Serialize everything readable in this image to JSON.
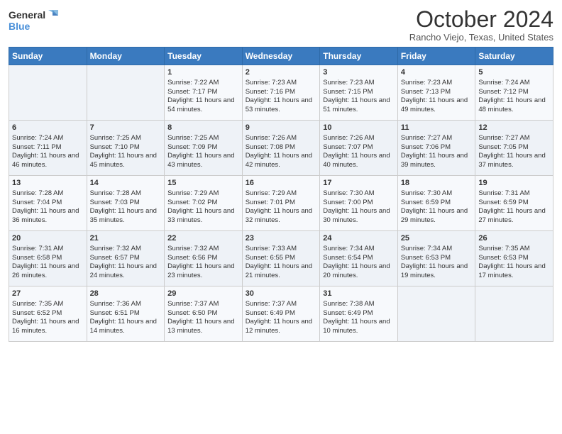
{
  "header": {
    "logo_line1": "General",
    "logo_line2": "Blue",
    "month": "October 2024",
    "location": "Rancho Viejo, Texas, United States"
  },
  "days_of_week": [
    "Sunday",
    "Monday",
    "Tuesday",
    "Wednesday",
    "Thursday",
    "Friday",
    "Saturday"
  ],
  "weeks": [
    [
      {
        "day": "",
        "info": ""
      },
      {
        "day": "",
        "info": ""
      },
      {
        "day": "1",
        "info": "Sunrise: 7:22 AM\nSunset: 7:17 PM\nDaylight: 11 hours and 54 minutes."
      },
      {
        "day": "2",
        "info": "Sunrise: 7:23 AM\nSunset: 7:16 PM\nDaylight: 11 hours and 53 minutes."
      },
      {
        "day": "3",
        "info": "Sunrise: 7:23 AM\nSunset: 7:15 PM\nDaylight: 11 hours and 51 minutes."
      },
      {
        "day": "4",
        "info": "Sunrise: 7:23 AM\nSunset: 7:13 PM\nDaylight: 11 hours and 49 minutes."
      },
      {
        "day": "5",
        "info": "Sunrise: 7:24 AM\nSunset: 7:12 PM\nDaylight: 11 hours and 48 minutes."
      }
    ],
    [
      {
        "day": "6",
        "info": "Sunrise: 7:24 AM\nSunset: 7:11 PM\nDaylight: 11 hours and 46 minutes."
      },
      {
        "day": "7",
        "info": "Sunrise: 7:25 AM\nSunset: 7:10 PM\nDaylight: 11 hours and 45 minutes."
      },
      {
        "day": "8",
        "info": "Sunrise: 7:25 AM\nSunset: 7:09 PM\nDaylight: 11 hours and 43 minutes."
      },
      {
        "day": "9",
        "info": "Sunrise: 7:26 AM\nSunset: 7:08 PM\nDaylight: 11 hours and 42 minutes."
      },
      {
        "day": "10",
        "info": "Sunrise: 7:26 AM\nSunset: 7:07 PM\nDaylight: 11 hours and 40 minutes."
      },
      {
        "day": "11",
        "info": "Sunrise: 7:27 AM\nSunset: 7:06 PM\nDaylight: 11 hours and 39 minutes."
      },
      {
        "day": "12",
        "info": "Sunrise: 7:27 AM\nSunset: 7:05 PM\nDaylight: 11 hours and 37 minutes."
      }
    ],
    [
      {
        "day": "13",
        "info": "Sunrise: 7:28 AM\nSunset: 7:04 PM\nDaylight: 11 hours and 36 minutes."
      },
      {
        "day": "14",
        "info": "Sunrise: 7:28 AM\nSunset: 7:03 PM\nDaylight: 11 hours and 35 minutes."
      },
      {
        "day": "15",
        "info": "Sunrise: 7:29 AM\nSunset: 7:02 PM\nDaylight: 11 hours and 33 minutes."
      },
      {
        "day": "16",
        "info": "Sunrise: 7:29 AM\nSunset: 7:01 PM\nDaylight: 11 hours and 32 minutes."
      },
      {
        "day": "17",
        "info": "Sunrise: 7:30 AM\nSunset: 7:00 PM\nDaylight: 11 hours and 30 minutes."
      },
      {
        "day": "18",
        "info": "Sunrise: 7:30 AM\nSunset: 6:59 PM\nDaylight: 11 hours and 29 minutes."
      },
      {
        "day": "19",
        "info": "Sunrise: 7:31 AM\nSunset: 6:59 PM\nDaylight: 11 hours and 27 minutes."
      }
    ],
    [
      {
        "day": "20",
        "info": "Sunrise: 7:31 AM\nSunset: 6:58 PM\nDaylight: 11 hours and 26 minutes."
      },
      {
        "day": "21",
        "info": "Sunrise: 7:32 AM\nSunset: 6:57 PM\nDaylight: 11 hours and 24 minutes."
      },
      {
        "day": "22",
        "info": "Sunrise: 7:32 AM\nSunset: 6:56 PM\nDaylight: 11 hours and 23 minutes."
      },
      {
        "day": "23",
        "info": "Sunrise: 7:33 AM\nSunset: 6:55 PM\nDaylight: 11 hours and 21 minutes."
      },
      {
        "day": "24",
        "info": "Sunrise: 7:34 AM\nSunset: 6:54 PM\nDaylight: 11 hours and 20 minutes."
      },
      {
        "day": "25",
        "info": "Sunrise: 7:34 AM\nSunset: 6:53 PM\nDaylight: 11 hours and 19 minutes."
      },
      {
        "day": "26",
        "info": "Sunrise: 7:35 AM\nSunset: 6:53 PM\nDaylight: 11 hours and 17 minutes."
      }
    ],
    [
      {
        "day": "27",
        "info": "Sunrise: 7:35 AM\nSunset: 6:52 PM\nDaylight: 11 hours and 16 minutes."
      },
      {
        "day": "28",
        "info": "Sunrise: 7:36 AM\nSunset: 6:51 PM\nDaylight: 11 hours and 14 minutes."
      },
      {
        "day": "29",
        "info": "Sunrise: 7:37 AM\nSunset: 6:50 PM\nDaylight: 11 hours and 13 minutes."
      },
      {
        "day": "30",
        "info": "Sunrise: 7:37 AM\nSunset: 6:49 PM\nDaylight: 11 hours and 12 minutes."
      },
      {
        "day": "31",
        "info": "Sunrise: 7:38 AM\nSunset: 6:49 PM\nDaylight: 11 hours and 10 minutes."
      },
      {
        "day": "",
        "info": ""
      },
      {
        "day": "",
        "info": ""
      }
    ]
  ]
}
